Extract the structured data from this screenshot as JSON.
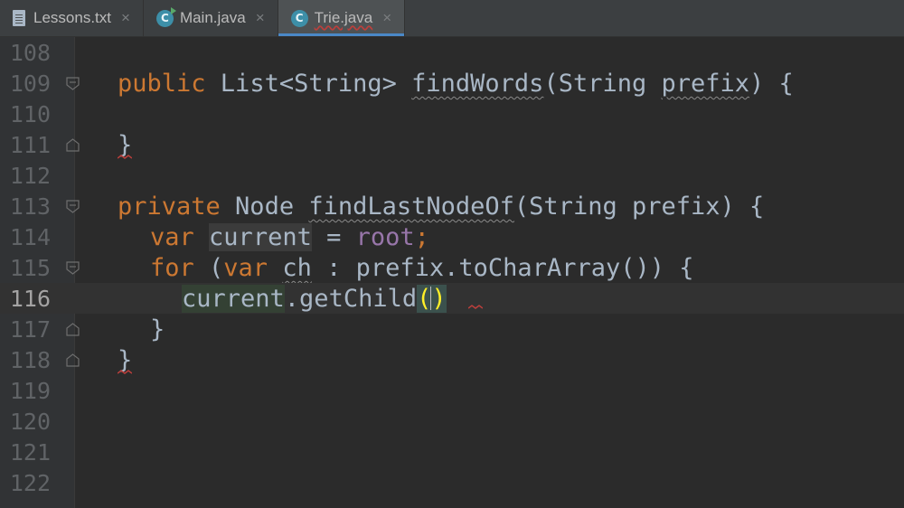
{
  "tabs": [
    {
      "label": "Lessons.txt",
      "icon": "text-file-icon",
      "active": false
    },
    {
      "label": "Main.java",
      "icon": "java-class-run-icon",
      "active": false
    },
    {
      "label": "Trie.java",
      "icon": "java-class-icon",
      "active": true
    }
  ],
  "tab_close_glyph": "×",
  "class_icon_letter": "C",
  "editor": {
    "current_line": 116,
    "lines": [
      {
        "n": "108"
      },
      {
        "n": "109"
      },
      {
        "n": "110"
      },
      {
        "n": "111"
      },
      {
        "n": "112"
      },
      {
        "n": "113"
      },
      {
        "n": "114"
      },
      {
        "n": "115"
      },
      {
        "n": "116"
      },
      {
        "n": "117"
      },
      {
        "n": "118"
      },
      {
        "n": "119"
      },
      {
        "n": "120"
      },
      {
        "n": "121"
      },
      {
        "n": "122"
      }
    ],
    "code": {
      "l109": {
        "kw": "public",
        "t1": " List<String> ",
        "fn": "findWords",
        "t2": "(String ",
        "p": "prefix",
        "t3": ") {"
      },
      "l111": {
        "t": "}"
      },
      "l113": {
        "kw": "private",
        "t1": " Node ",
        "fn": "findLastNodeOf",
        "t2": "(String prefix) {"
      },
      "l114": {
        "kw": "var",
        "v": "current",
        "t1": " = ",
        "fld": "root",
        "semi": ";"
      },
      "l115": {
        "kw": "for",
        "t1": " (",
        "kw2": "var",
        "v": "ch",
        "t2": " : prefix.toCharArray()) {"
      },
      "l116": {
        "v": "current",
        "t1": ".getChild",
        "po": "(",
        "pc": ")"
      },
      "l117": {
        "t": "}"
      },
      "l118": {
        "t": "}"
      }
    }
  },
  "colors": {
    "background": "#2b2b2b",
    "keyword": "#cc7832",
    "text": "#a9b7c6",
    "field": "#9876aa",
    "error_squiggle": "#bc3f3c",
    "tab_active_underline": "#4a88c7"
  }
}
